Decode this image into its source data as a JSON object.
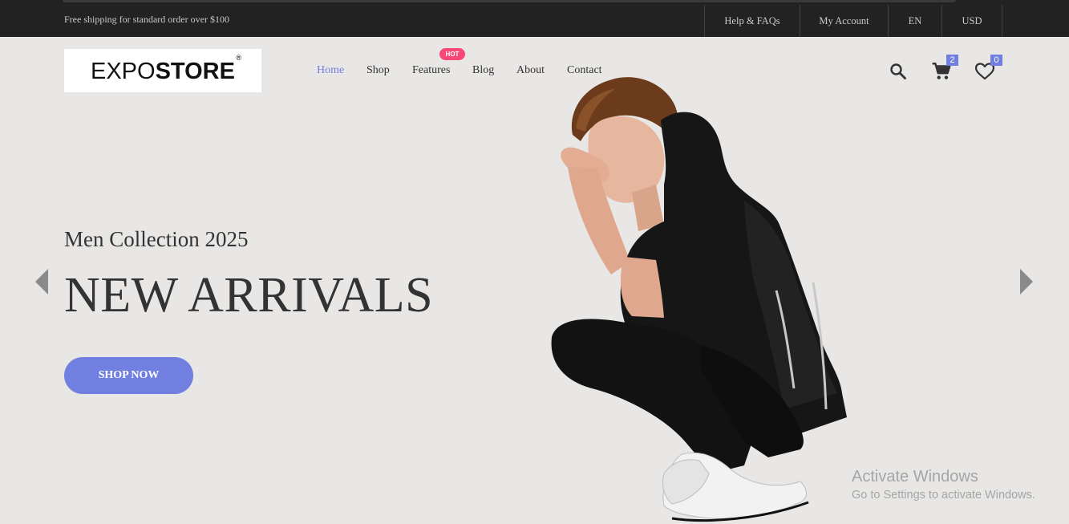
{
  "topbar": {
    "shipping_notice": "Free shipping for standard order over $100",
    "links": [
      {
        "label": "Help & FAQs"
      },
      {
        "label": "My Account"
      },
      {
        "label": "EN"
      },
      {
        "label": "USD"
      }
    ]
  },
  "header": {
    "logo": {
      "part1": "EXPO",
      "part2": "STORE",
      "registered": "®"
    },
    "nav": [
      {
        "label": "Home",
        "active": true
      },
      {
        "label": "Shop",
        "active": false
      },
      {
        "label": "Features",
        "active": false,
        "badge": "HOT"
      },
      {
        "label": "Blog",
        "active": false
      },
      {
        "label": "About",
        "active": false
      },
      {
        "label": "Contact",
        "active": false
      }
    ],
    "icons": {
      "search": "search-icon",
      "cart": "cart-icon",
      "wishlist": "heart-icon"
    },
    "cart_count": "2",
    "wishlist_count": "0"
  },
  "hero": {
    "subtitle": "Men Collection 2025",
    "headline": "NEW ARRIVALS",
    "cta": "SHOP NOW"
  },
  "colors": {
    "accent": "#717fe0",
    "hot": "#f74877",
    "topbar": "#222222",
    "background": "#e8e7e5"
  },
  "watermark": {
    "line1": "Activate Windows",
    "line2": "Go to Settings to activate Windows."
  }
}
